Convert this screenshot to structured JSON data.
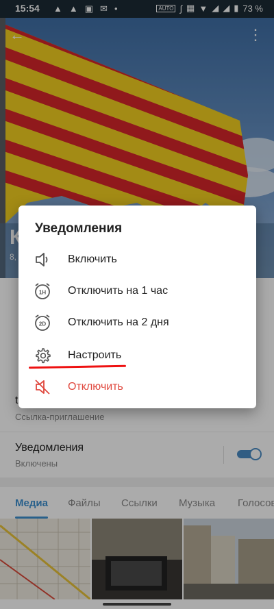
{
  "status_bar": {
    "time": "15:54",
    "battery_percent": "73 %",
    "left_icons": [
      "notification-icon",
      "notification-icon",
      "gallery-icon",
      "mail-icon",
      "dot-icon"
    ],
    "right_icons": [
      "auto-icon",
      "bluetooth-icon",
      "nfc-icon",
      "wifi-icon",
      "signal-icon",
      "signal-2r-icon",
      "battery-icon"
    ]
  },
  "header": {
    "back_icon": "arrow-back-icon",
    "menu_icon": "more-vert-icon",
    "profile_initial": "К",
    "profile_sub": "8,"
  },
  "info": {
    "link_value": "t",
    "link_label": "Ссылка-приглашение",
    "notifications_title": "Уведомления",
    "notifications_status": "Включены",
    "notifications_enabled": true
  },
  "tabs": {
    "items": [
      "Медиа",
      "Файлы",
      "Ссылки",
      "Музыка",
      "Голосов"
    ],
    "active": 0
  },
  "dialog": {
    "title": "Уведомления",
    "items": [
      {
        "label": "Включить",
        "icon": "speaker-icon"
      },
      {
        "label": "Отключить на 1 час",
        "icon": "alarm-1h-icon",
        "icon_text": "1H"
      },
      {
        "label": "Отключить на 2 дня",
        "icon": "alarm-2d-icon",
        "icon_text": "2D"
      },
      {
        "label": "Настроить",
        "icon": "gear-icon"
      },
      {
        "label": "Отключить",
        "icon": "speaker-muted-icon",
        "danger": true
      }
    ]
  },
  "colors": {
    "accent": "#3d8fd0",
    "danger": "#e0483e",
    "flag_red": "#d7262b",
    "flag_yellow": "#f3d020",
    "annotation_red": "#ee1111"
  }
}
